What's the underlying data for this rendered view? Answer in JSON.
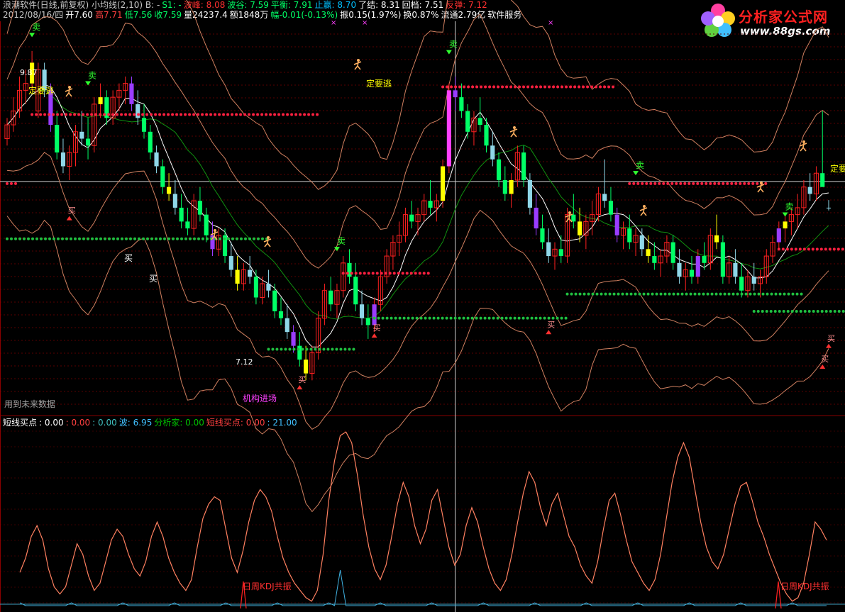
{
  "header": {
    "line1": [
      {
        "text": "浪潮软件(日线,前复权) 小均线(2,10) B: -",
        "color": "#c8c8c8"
      },
      {
        "text": "S1: -",
        "color": "#00ff66"
      },
      {
        "text": "波峰: 8.08",
        "color": "#ff3030"
      },
      {
        "text": "波谷: 7.59",
        "color": "#00ff66"
      },
      {
        "text": "平衡: 7.91",
        "color": "#00ff66"
      },
      {
        "text": "止赢: 8.70",
        "color": "#00c0ff"
      },
      {
        "text": "了结: 8.31",
        "color": "#ffffff"
      },
      {
        "text": "回档: 7.51",
        "color": "#ffffff"
      },
      {
        "text": "反弹: 7.12",
        "color": "#ff3030"
      }
    ],
    "line2": [
      {
        "text": "2012/08/16/四",
        "color": "#c8c8c8"
      },
      {
        "text": "开7.60",
        "color": "#ffffff"
      },
      {
        "text": "高7.71",
        "color": "#ff4040"
      },
      {
        "text": "低7.56",
        "color": "#00ff66"
      },
      {
        "text": "收7.59",
        "color": "#00ff66"
      },
      {
        "text": "量24237.4",
        "color": "#ffffff"
      },
      {
        "text": "额1848万",
        "color": "#ffffff"
      },
      {
        "text": "幅-0.01(-0.13%)",
        "color": "#00ff66"
      },
      {
        "text": "振0.15(1.97%)",
        "color": "#ffffff"
      },
      {
        "text": "换0.87%",
        "color": "#ffffff"
      },
      {
        "text": "流通2.79亿",
        "color": "#ffffff"
      },
      {
        "text": "软件服务",
        "color": "#ffffff"
      }
    ],
    "sub": [
      {
        "text": "短线买点",
        "color": "#ffffff"
      },
      {
        "text": ": 0.00",
        "color": "#ffffff"
      },
      {
        "text": ": 0.00",
        "color": "#ff4040"
      },
      {
        "text": ": 0.00",
        "color": "#40c0c0"
      },
      {
        "text": "波: 6.95",
        "color": "#40c0ff"
      },
      {
        "text": "分析家: 0.00",
        "color": "#00c000"
      },
      {
        "text": "短线买点: 0.00",
        "color": "#ff4040"
      },
      {
        "text": ": 21.00",
        "color": "#40c0ff"
      }
    ]
  },
  "logo": {
    "title": "分析家公式网",
    "url": "www.88gs.com"
  },
  "colors": {
    "up": "#ff2020",
    "down": "#00ff66",
    "yellow": "#ffff00",
    "purple": "#9a3cff",
    "cyan": "#8fd7e8",
    "magenta": "#ff40ff",
    "white": "#ffffff",
    "upperBand": "#d08060",
    "lowerBand": "#d08060",
    "midLine": "#ffffff",
    "greenLine": "#109010",
    "kline": "#ff8060",
    "dotRed": "#ff2040",
    "dotGreen": "#20c040"
  },
  "chart_data": {
    "type": "candlestick",
    "main_panel": {
      "price_labels": [
        {
          "text": "9.87",
          "index": 4
        },
        {
          "text": "7.12",
          "index": 58
        }
      ],
      "hline_price": 7.98,
      "crosshair_index": 72,
      "annotations": [
        {
          "text": "定要逃",
          "color": "#ffff00"
        },
        {
          "text": "定要逃",
          "color": "#ffff00"
        },
        {
          "text": "定要",
          "color": "#ffff00"
        },
        {
          "text": "机构进场",
          "color": "#ff40ff"
        },
        {
          "text": "用到未来数据",
          "color": "#a0a0a0"
        },
        {
          "text": "卖",
          "color": "#30ff30"
        },
        {
          "text": "买",
          "color": "#ffffff"
        }
      ]
    },
    "candles": [
      [
        8.6,
        8.9,
        8.5,
        8.8
      ],
      [
        8.8,
        9.2,
        8.7,
        9.0
      ],
      [
        9.0,
        9.5,
        8.9,
        9.3
      ],
      [
        9.3,
        9.6,
        9.1,
        9.4
      ],
      [
        9.4,
        9.87,
        9.3,
        9.7
      ],
      [
        9.0,
        9.7,
        8.9,
        9.6
      ],
      [
        9.6,
        9.7,
        9.2,
        9.3
      ],
      [
        9.3,
        9.4,
        8.7,
        8.8
      ],
      [
        8.8,
        9.0,
        8.3,
        8.4
      ],
      [
        8.4,
        8.6,
        8.1,
        8.2
      ],
      [
        8.2,
        8.5,
        8.0,
        8.4
      ],
      [
        8.4,
        8.8,
        8.2,
        8.7
      ],
      [
        8.7,
        9.0,
        8.5,
        8.6
      ],
      [
        8.6,
        8.9,
        8.3,
        8.5
      ],
      [
        8.5,
        9.2,
        8.4,
        9.1
      ],
      [
        9.1,
        9.4,
        8.9,
        9.2
      ],
      [
        9.2,
        9.3,
        8.8,
        8.9
      ],
      [
        8.9,
        9.3,
        8.8,
        9.2
      ],
      [
        9.2,
        9.4,
        9.0,
        9.3
      ],
      [
        9.3,
        9.5,
        9.1,
        9.4
      ],
      [
        9.4,
        9.5,
        9.0,
        9.1
      ],
      [
        9.1,
        9.3,
        8.8,
        8.9
      ],
      [
        8.9,
        9.1,
        8.6,
        8.7
      ],
      [
        8.7,
        8.8,
        8.3,
        8.4
      ],
      [
        8.4,
        8.5,
        8.1,
        8.2
      ],
      [
        8.2,
        8.3,
        7.8,
        7.9
      ],
      [
        7.9,
        8.1,
        7.7,
        7.8
      ],
      [
        7.8,
        8.0,
        7.5,
        7.6
      ],
      [
        7.6,
        7.8,
        7.3,
        7.4
      ],
      [
        7.4,
        7.6,
        7.2,
        7.3
      ],
      [
        7.3,
        7.8,
        7.2,
        7.7
      ],
      [
        7.7,
        7.9,
        7.4,
        7.5
      ],
      [
        7.5,
        7.6,
        7.1,
        7.2
      ],
      [
        7.2,
        7.4,
        6.9,
        7.0
      ],
      [
        7.0,
        7.3,
        6.9,
        7.2
      ],
      [
        7.2,
        7.3,
        6.8,
        6.9
      ],
      [
        6.9,
        7.1,
        6.6,
        6.7
      ],
      [
        6.7,
        6.9,
        6.4,
        6.5
      ],
      [
        6.5,
        6.8,
        6.4,
        6.7
      ],
      [
        6.7,
        6.9,
        6.5,
        6.6
      ],
      [
        6.6,
        6.7,
        6.2,
        6.3
      ],
      [
        6.3,
        6.6,
        6.2,
        6.5
      ],
      [
        6.5,
        6.7,
        6.3,
        6.4
      ],
      [
        6.4,
        6.5,
        6.0,
        6.1
      ],
      [
        6.1,
        6.3,
        5.9,
        6.0
      ],
      [
        6.0,
        6.2,
        5.7,
        5.8
      ],
      [
        5.8,
        5.9,
        5.5,
        5.6
      ],
      [
        5.6,
        5.8,
        5.3,
        5.4
      ],
      [
        5.4,
        5.6,
        5.1,
        5.2
      ],
      [
        5.2,
        5.6,
        5.1,
        5.5
      ],
      [
        5.5,
        6.1,
        5.4,
        6.0
      ],
      [
        6.0,
        6.5,
        5.9,
        6.4
      ],
      [
        6.4,
        6.6,
        6.1,
        6.2
      ],
      [
        6.2,
        6.5,
        6.0,
        6.4
      ],
      [
        6.4,
        6.9,
        6.3,
        6.8
      ],
      [
        6.8,
        7.0,
        6.5,
        6.6
      ],
      [
        6.6,
        6.8,
        6.1,
        6.2
      ],
      [
        6.2,
        6.4,
        5.9,
        6.0
      ],
      [
        6.0,
        6.2,
        5.7,
        5.9
      ],
      [
        5.9,
        6.3,
        5.8,
        6.2
      ],
      [
        6.2,
        6.7,
        6.1,
        6.6
      ],
      [
        6.6,
        7.0,
        6.5,
        6.9
      ],
      [
        6.9,
        7.2,
        6.7,
        7.1
      ],
      [
        7.1,
        7.4,
        6.9,
        7.2
      ],
      [
        7.2,
        7.6,
        7.1,
        7.5
      ],
      [
        7.5,
        7.7,
        7.3,
        7.4
      ],
      [
        7.4,
        7.6,
        7.2,
        7.5
      ],
      [
        7.5,
        7.8,
        7.4,
        7.7
      ],
      [
        7.7,
        8.0,
        7.5,
        7.6
      ],
      [
        7.6,
        7.8,
        7.4,
        7.7
      ],
      [
        7.7,
        8.3,
        7.6,
        8.2
      ],
      [
        8.2,
        9.4,
        8.1,
        9.3
      ],
      [
        9.3,
        9.5,
        9.0,
        9.2
      ],
      [
        9.2,
        9.4,
        8.9,
        9.0
      ],
      [
        9.0,
        9.1,
        8.6,
        8.7
      ],
      [
        8.7,
        9.0,
        8.5,
        8.9
      ],
      [
        8.9,
        9.2,
        8.7,
        8.8
      ],
      [
        8.8,
        8.9,
        8.4,
        8.5
      ],
      [
        8.5,
        8.7,
        8.2,
        8.3
      ],
      [
        8.3,
        8.4,
        7.9,
        8.0
      ],
      [
        8.0,
        8.2,
        7.7,
        7.8
      ],
      [
        7.8,
        8.1,
        7.6,
        8.0
      ],
      [
        8.0,
        8.5,
        7.9,
        8.4
      ],
      [
        8.4,
        8.5,
        7.9,
        8.0
      ],
      [
        8.0,
        8.1,
        7.5,
        7.6
      ],
      [
        7.6,
        7.8,
        7.2,
        7.3
      ],
      [
        7.3,
        7.5,
        7.0,
        7.1
      ],
      [
        7.1,
        7.3,
        6.8,
        6.9
      ],
      [
        6.9,
        7.1,
        6.7,
        7.0
      ],
      [
        7.0,
        7.2,
        6.8,
        6.9
      ],
      [
        6.9,
        7.6,
        6.8,
        7.5
      ],
      [
        7.5,
        7.8,
        7.3,
        7.4
      ],
      [
        7.4,
        7.6,
        7.1,
        7.2
      ],
      [
        7.2,
        7.5,
        7.0,
        7.4
      ],
      [
        7.4,
        7.7,
        7.2,
        7.5
      ],
      [
        7.5,
        7.9,
        7.4,
        7.8
      ],
      [
        7.8,
        8.3,
        7.6,
        7.7
      ],
      [
        7.7,
        7.9,
        7.4,
        7.5
      ],
      [
        7.5,
        7.6,
        7.1,
        7.2
      ],
      [
        7.2,
        7.4,
        7.0,
        7.3
      ],
      [
        7.3,
        7.5,
        7.0,
        7.1
      ],
      [
        7.1,
        7.3,
        6.9,
        7.2
      ],
      [
        7.2,
        7.3,
        6.9,
        7.0
      ],
      [
        7.0,
        7.2,
        6.8,
        6.9
      ],
      [
        6.9,
        7.1,
        6.7,
        6.8
      ],
      [
        6.8,
        7.0,
        6.6,
        6.9
      ],
      [
        6.9,
        7.2,
        6.8,
        7.1
      ],
      [
        7.1,
        7.2,
        6.7,
        6.8
      ],
      [
        6.8,
        7.0,
        6.5,
        6.6
      ],
      [
        6.6,
        6.8,
        6.4,
        6.7
      ],
      [
        6.7,
        6.9,
        6.5,
        6.6
      ],
      [
        6.6,
        7.0,
        6.5,
        6.9
      ],
      [
        6.9,
        7.1,
        6.7,
        6.8
      ],
      [
        6.8,
        7.3,
        6.7,
        7.2
      ],
      [
        7.2,
        7.5,
        7.0,
        7.1
      ],
      [
        7.1,
        7.2,
        6.5,
        6.6
      ],
      [
        6.6,
        6.9,
        6.5,
        6.8
      ],
      [
        6.8,
        7.0,
        6.5,
        6.6
      ],
      [
        6.6,
        6.8,
        6.3,
        6.4
      ],
      [
        6.4,
        6.7,
        6.3,
        6.6
      ],
      [
        6.6,
        6.8,
        6.4,
        6.5
      ],
      [
        6.5,
        6.7,
        6.3,
        6.6
      ],
      [
        6.6,
        7.0,
        6.5,
        6.9
      ],
      [
        6.9,
        7.2,
        6.8,
        7.1
      ],
      [
        7.1,
        7.4,
        7.0,
        7.3
      ],
      [
        7.3,
        7.5,
        7.1,
        7.4
      ],
      [
        7.4,
        7.6,
        7.2,
        7.5
      ],
      [
        7.5,
        7.8,
        7.3,
        7.6
      ],
      [
        7.6,
        8.0,
        7.5,
        7.9
      ],
      [
        7.9,
        8.1,
        7.7,
        7.8
      ],
      [
        7.8,
        8.2,
        7.7,
        8.1
      ],
      [
        8.1,
        9.0,
        8.0,
        7.9
      ],
      [
        7.6,
        7.71,
        7.56,
        7.59
      ]
    ],
    "kline_values": [
      20,
      28,
      40,
      46,
      38,
      22,
      12,
      8,
      12,
      24,
      36,
      30,
      18,
      10,
      14,
      26,
      38,
      44,
      40,
      30,
      22,
      18,
      26,
      40,
      48,
      40,
      28,
      20,
      14,
      10,
      16,
      34,
      50,
      58,
      62,
      60,
      44,
      28,
      20,
      32,
      48,
      60,
      66,
      62,
      54,
      40,
      28,
      20,
      14,
      10,
      6,
      4,
      10,
      30,
      60,
      82,
      96,
      98,
      92,
      74,
      52,
      34,
      22,
      16,
      24,
      40,
      58,
      70,
      62,
      46,
      36,
      44,
      60,
      66,
      50,
      34,
      24,
      30,
      46,
      56,
      48,
      34,
      22,
      14,
      10,
      16,
      30,
      48,
      64,
      76,
      70,
      56,
      46,
      58,
      64,
      52,
      40,
      34,
      24,
      18,
      14,
      26,
      44,
      60,
      64,
      52,
      38,
      26,
      20,
      14,
      10,
      16,
      30,
      50,
      70,
      84,
      92,
      84,
      66,
      48,
      34,
      26,
      22,
      30,
      44,
      58,
      68,
      70,
      60,
      48,
      40,
      30,
      22,
      14,
      8,
      4,
      6,
      14,
      30,
      48,
      44,
      38
    ],
    "kline_range": [
      0,
      100
    ],
    "kline_labels": [
      {
        "text": "日周KDJ共振",
        "index": 38
      },
      {
        "text": "日周KDJ共振",
        "index": 136
      }
    ]
  }
}
